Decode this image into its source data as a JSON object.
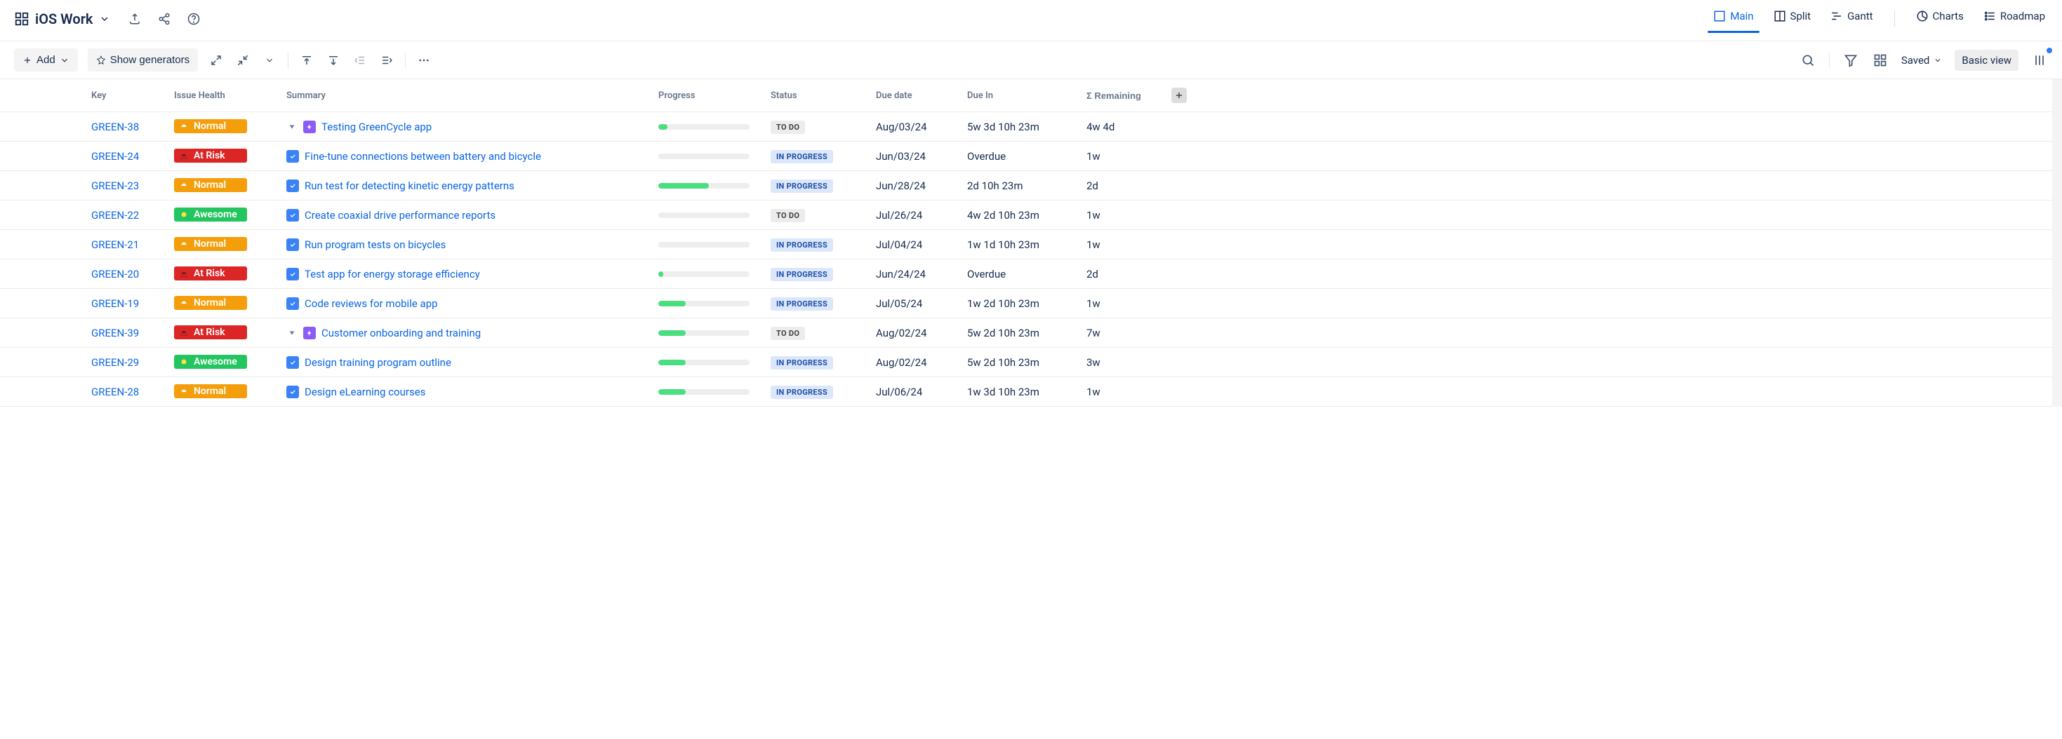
{
  "header": {
    "title": "iOS Work",
    "views": [
      {
        "id": "main",
        "label": "Main",
        "active": true
      },
      {
        "id": "split",
        "label": "Split",
        "active": false
      },
      {
        "id": "gantt",
        "label": "Gantt",
        "active": false
      },
      {
        "id": "charts",
        "label": "Charts",
        "active": false
      },
      {
        "id": "roadmap",
        "label": "Roadmap",
        "active": false
      }
    ]
  },
  "toolbar": {
    "add_label": "Add",
    "show_generators_label": "Show generators",
    "saved_label": "Saved",
    "basic_view_label": "Basic view"
  },
  "columns": {
    "key": "Key",
    "issue_health": "Issue Health",
    "summary": "Summary",
    "progress": "Progress",
    "status": "Status",
    "due_date": "Due date",
    "due_in": "Due In",
    "remaining": "Σ Remaining"
  },
  "health_labels": {
    "normal": "Normal",
    "atrisk": "At Risk",
    "awesome": "Awesome"
  },
  "status_labels": {
    "todo": "TO DO",
    "inprogress": "IN PROGRESS"
  },
  "rows": [
    {
      "key": "GREEN-38",
      "health": "normal",
      "level": 0,
      "expandable": true,
      "type": "epic",
      "summary": "Testing GreenCycle app",
      "progress": 10,
      "status": "todo",
      "due_date": "Aug/03/24",
      "due_in": "5w 3d 10h 23m",
      "remaining": "4w 4d"
    },
    {
      "key": "GREEN-24",
      "health": "atrisk",
      "level": 1,
      "expandable": false,
      "type": "task",
      "summary": "Fine-tune connections between battery and bicycle",
      "progress": 0,
      "status": "inprogress",
      "due_date": "Jun/03/24",
      "due_in": "Overdue",
      "remaining": "1w"
    },
    {
      "key": "GREEN-23",
      "health": "normal",
      "level": 1,
      "expandable": false,
      "type": "task",
      "summary": "Run test for detecting kinetic energy patterns",
      "progress": 55,
      "status": "inprogress",
      "due_date": "Jun/28/24",
      "due_in": "2d 10h 23m",
      "remaining": "2d"
    },
    {
      "key": "GREEN-22",
      "health": "awesome",
      "level": 1,
      "expandable": false,
      "type": "task",
      "summary": "Create coaxial drive performance reports",
      "progress": 0,
      "status": "todo",
      "due_date": "Jul/26/24",
      "due_in": "4w 2d 10h 23m",
      "remaining": "1w"
    },
    {
      "key": "GREEN-21",
      "health": "normal",
      "level": 1,
      "expandable": false,
      "type": "task",
      "summary": "Run program tests on bicycles",
      "progress": 0,
      "status": "inprogress",
      "due_date": "Jul/04/24",
      "due_in": "1w 1d 10h 23m",
      "remaining": "1w"
    },
    {
      "key": "GREEN-20",
      "health": "atrisk",
      "level": 1,
      "expandable": false,
      "type": "task",
      "summary": "Test app for energy storage efficiency",
      "progress": 5,
      "status": "inprogress",
      "due_date": "Jun/24/24",
      "due_in": "Overdue",
      "remaining": "2d"
    },
    {
      "key": "GREEN-19",
      "health": "normal",
      "level": 1,
      "expandable": false,
      "type": "task",
      "summary": "Code reviews for mobile app",
      "progress": 30,
      "status": "inprogress",
      "due_date": "Jul/05/24",
      "due_in": "1w 2d 10h 23m",
      "remaining": "1w"
    },
    {
      "key": "GREEN-39",
      "health": "atrisk",
      "level": 0,
      "expandable": true,
      "type": "epic",
      "summary": "Customer onboarding and training",
      "progress": 30,
      "status": "todo",
      "due_date": "Aug/02/24",
      "due_in": "5w 2d 10h 23m",
      "remaining": "7w"
    },
    {
      "key": "GREEN-29",
      "health": "awesome",
      "level": 1,
      "expandable": false,
      "type": "task",
      "summary": "Design training program outline",
      "progress": 30,
      "status": "inprogress",
      "due_date": "Aug/02/24",
      "due_in": "5w 2d 10h 23m",
      "remaining": "3w"
    },
    {
      "key": "GREEN-28",
      "health": "normal",
      "level": 1,
      "expandable": false,
      "type": "task",
      "summary": "Design eLearning courses",
      "progress": 30,
      "status": "inprogress",
      "due_date": "Jul/06/24",
      "due_in": "1w 3d 10h 23m",
      "remaining": "1w"
    }
  ]
}
